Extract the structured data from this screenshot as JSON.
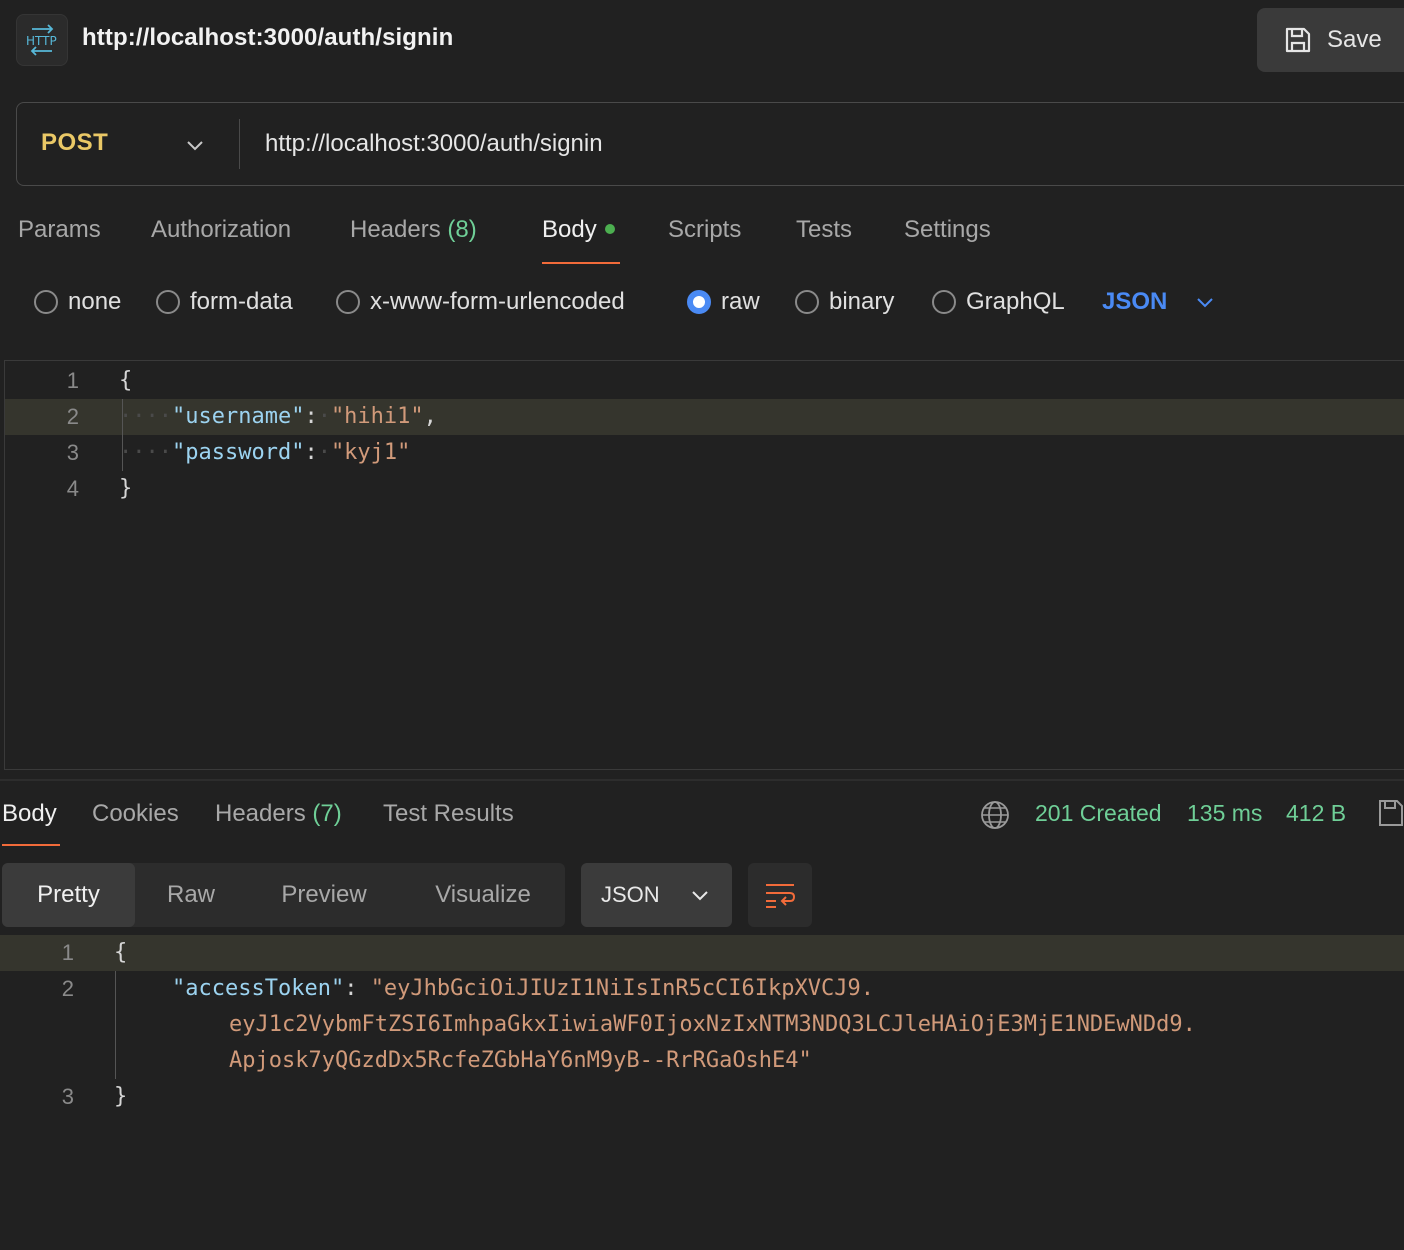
{
  "header": {
    "icon": "http-icon",
    "icon_label": "HTTP",
    "title": "http://localhost:3000/auth/signin",
    "save_label": "Save"
  },
  "request": {
    "method": "POST",
    "url": "http://localhost:3000/auth/signin",
    "tabs": {
      "params": "Params",
      "authorization": "Authorization",
      "headers": "Headers",
      "headers_count": "(8)",
      "body": "Body",
      "scripts": "Scripts",
      "tests": "Tests",
      "settings": "Settings"
    },
    "body_types": {
      "none": "none",
      "form_data": "form-data",
      "urlencoded": "x-www-form-urlencoded",
      "raw": "raw",
      "binary": "binary",
      "graphql": "GraphQL",
      "selected": "raw",
      "format": "JSON"
    },
    "editor": {
      "line_numbers": [
        "1",
        "2",
        "3",
        "4"
      ],
      "open": "{",
      "close": "}",
      "ws": "····",
      "username_key": "\"username\"",
      "username_value": "\"hihi1\"",
      "password_key": "\"password\"",
      "password_value": "\"kyj1\"",
      "colon": ":",
      "comma": ","
    }
  },
  "response": {
    "tabs": {
      "body": "Body",
      "cookies": "Cookies",
      "headers": "Headers",
      "headers_count": "(7)",
      "test_results": "Test Results"
    },
    "status": "201 Created",
    "time": "135 ms",
    "size": "412 B",
    "views": {
      "pretty": "Pretty",
      "raw": "Raw",
      "preview": "Preview",
      "visualize": "Visualize",
      "format": "JSON"
    },
    "body": {
      "line_numbers": [
        "1",
        "2",
        "3"
      ],
      "open": "{",
      "close": "}",
      "key": "\"accessToken\"",
      "colon": ":",
      "token_line1": "\"eyJhbGciOiJIUzI1NiIsInR5cCI6IkpXVCJ9.",
      "token_line2": "eyJ1c2VybmFtZSI6ImhpaGkxIiwiaWF0IjoxNzIxNTM3NDQ3LCJleHAiOjE3MjE1NDEwNDd9.",
      "token_line3": "Apjosk7yQGzdDx5RcfeZGbHaY6nM9yB--RrRGaOshE4\""
    }
  },
  "colors": {
    "background": "#212121",
    "method": "#eac866",
    "accent_tab": "#f26b3a",
    "status_green": "#6fcf97",
    "link_blue": "#4a8af4",
    "json_key": "#9cd3f0",
    "json_string": "#d19a7a"
  }
}
